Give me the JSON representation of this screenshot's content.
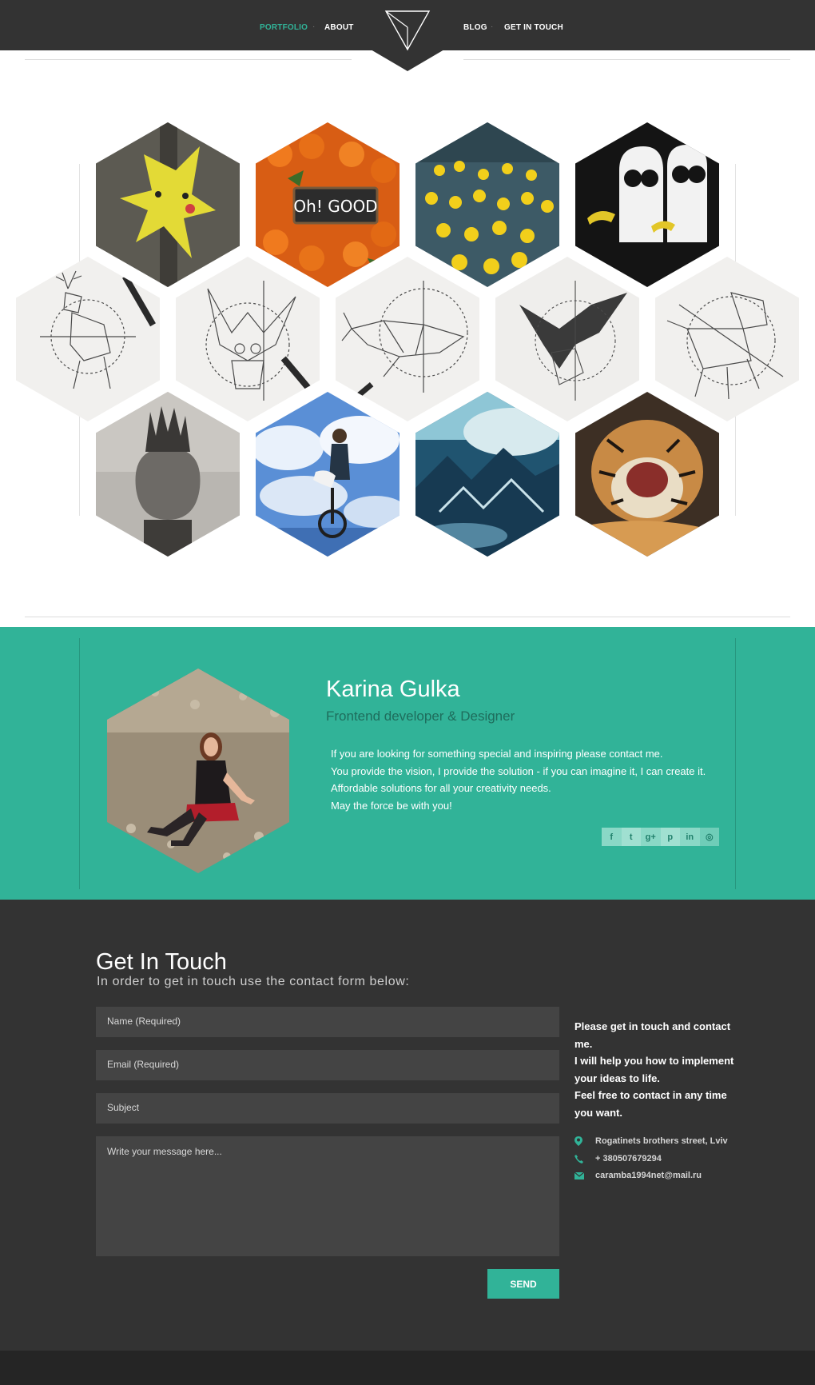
{
  "nav": {
    "items": [
      {
        "label": "PORTFOLIO",
        "active": true
      },
      {
        "label": "ABOUT",
        "active": false
      },
      {
        "label": "BLOG",
        "active": false
      },
      {
        "label": "GET IN TOUCH",
        "active": false
      }
    ],
    "logo_icon": "triangle-logo-icon"
  },
  "portfolio": {
    "items": [
      {
        "image": "pikachu-road-graffiti"
      },
      {
        "image": "oranges-oh-so-good-sign"
      },
      {
        "image": "rubber-ducks-pond"
      },
      {
        "image": "pulp-fiction-minions"
      },
      {
        "image": "geometric-deer-sketch"
      },
      {
        "image": "geometric-owl-sketch"
      },
      {
        "image": "geometric-whale-sketch"
      },
      {
        "image": "geometric-raven-sketch"
      },
      {
        "image": "geometric-tiger-sketch"
      },
      {
        "image": "cat-head-castle"
      },
      {
        "image": "cyclist-in-clouds"
      },
      {
        "image": "mountains-above-clouds"
      },
      {
        "image": "roaring-tiger"
      }
    ]
  },
  "about": {
    "name": "Karina Gulka",
    "role": "Frontend developer & Designer",
    "lines": [
      "If you are looking for something special and inspiring please contact me.",
      "You provide the vision, I provide the solution - if you can imagine it, I can create it.",
      "Affordable solutions for all your creativity needs.",
      "May the force be with you!"
    ],
    "social": [
      {
        "icon": "facebook-icon",
        "glyph": "f"
      },
      {
        "icon": "twitter-icon",
        "glyph": "t"
      },
      {
        "icon": "google-plus-icon",
        "glyph": "g+"
      },
      {
        "icon": "pinterest-icon",
        "glyph": "p"
      },
      {
        "icon": "linkedin-icon",
        "glyph": "in"
      },
      {
        "icon": "dribbble-icon",
        "glyph": "◎"
      }
    ]
  },
  "contact": {
    "title": "Get In Touch",
    "subtitle": "In order to get in touch use the contact form below:",
    "name_placeholder": "Name (Required)",
    "email_placeholder": "Email (Required)",
    "subject_placeholder": "Subject",
    "message_placeholder": "Write your message here...",
    "send_label": "SEND",
    "info_lines": [
      "Please get in touch and contact me.",
      "I will help you how to implement your ideas to life.",
      "Feel free to contact in any time you want."
    ],
    "address": "Rogatinets brothers street, Lviv",
    "phone": "+ 380507679294",
    "email": "caramba1994net@mail.ru"
  },
  "colors": {
    "accent": "#31b398",
    "dark": "#333333",
    "field": "#444444",
    "footer": "#252525"
  }
}
